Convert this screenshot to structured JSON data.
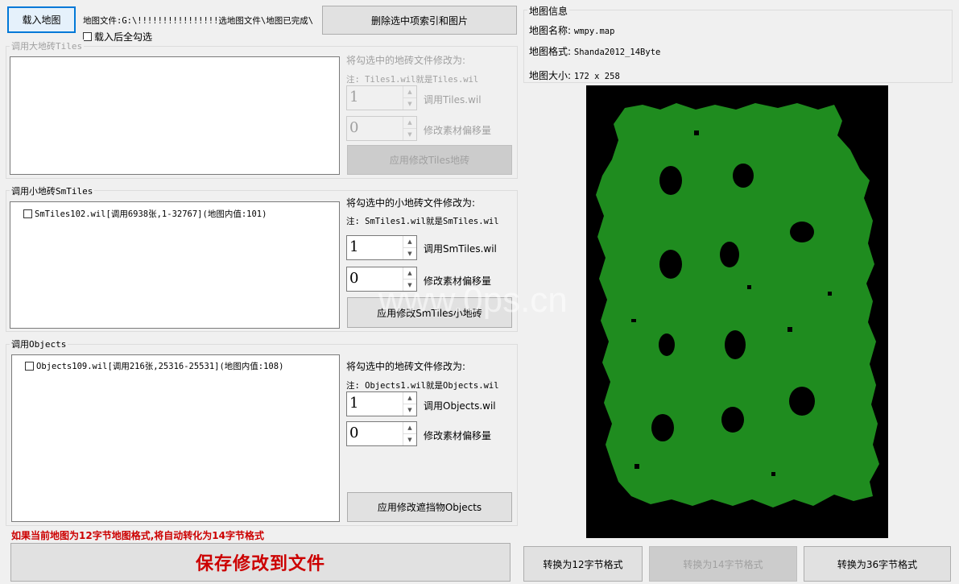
{
  "top": {
    "load_map_button": "载入地图",
    "map_file_label": "地图文件:G:\\!!!!!!!!!!!!!!!!选地图文件\\地图已完成\\",
    "select_all_after_load": "载入后全勾选",
    "delete_selected_button": "删除选中项索引和图片"
  },
  "tiles": {
    "group_title": "调用大地砖Tiles",
    "modify_label": "将勾选中的地砖文件修改为:",
    "note": "注: Tiles1.wil就是Tiles.wil",
    "spin1_value": "1",
    "spin1_label": "调用Tiles.wil",
    "spin2_value": "0",
    "spin2_label": "修改素材偏移量",
    "apply_button": "应用修改Tiles地砖"
  },
  "smtiles": {
    "group_title": "调用小地砖SmTiles",
    "item": "SmTiles102.wil[调用6938张,1-32767](地图内值:101)",
    "modify_label": "将勾选中的小地砖文件修改为:",
    "note": "注: SmTiles1.wil就是SmTiles.wil",
    "spin1_value": "1",
    "spin1_label": "调用SmTiles.wil",
    "spin2_value": "0",
    "spin2_label": "修改素材偏移量",
    "apply_button": "应用修改SmTiles小地砖"
  },
  "objects": {
    "group_title": "调用Objects",
    "item": "Objects109.wil[调用216张,25316-25531](地图内值:108)",
    "modify_label": "将勾选中的地砖文件修改为:",
    "note": "注: Objects1.wil就是Objects.wil",
    "spin1_value": "1",
    "spin1_label": "调用Objects.wil",
    "spin2_value": "0",
    "spin2_label": "修改素材偏移量",
    "apply_button": "应用修改遮挡物Objects"
  },
  "bottom": {
    "warning": "如果当前地图为12字节地图格式,将自动转化为14字节格式",
    "save_button": "保存修改到文件",
    "to12_button": "转换为12字节格式",
    "to14_button": "转换为14字节格式",
    "to36_button": "转换为36字节格式"
  },
  "map_info": {
    "group_title": "地图信息",
    "name_label": "地图名称:",
    "name_value": "wmpy.map",
    "format_label": "地图格式:",
    "format_value": "Shanda2012_14Byte",
    "size_label": "地图大小:",
    "size_value": "172 x 258"
  },
  "watermark": "www.0ps.cn",
  "colors": {
    "map_background": "#000000",
    "map_land": "#1f8c1f",
    "warning_text": "#cc0000",
    "save_text": "#cc0000",
    "focus_border": "#0078d7"
  }
}
